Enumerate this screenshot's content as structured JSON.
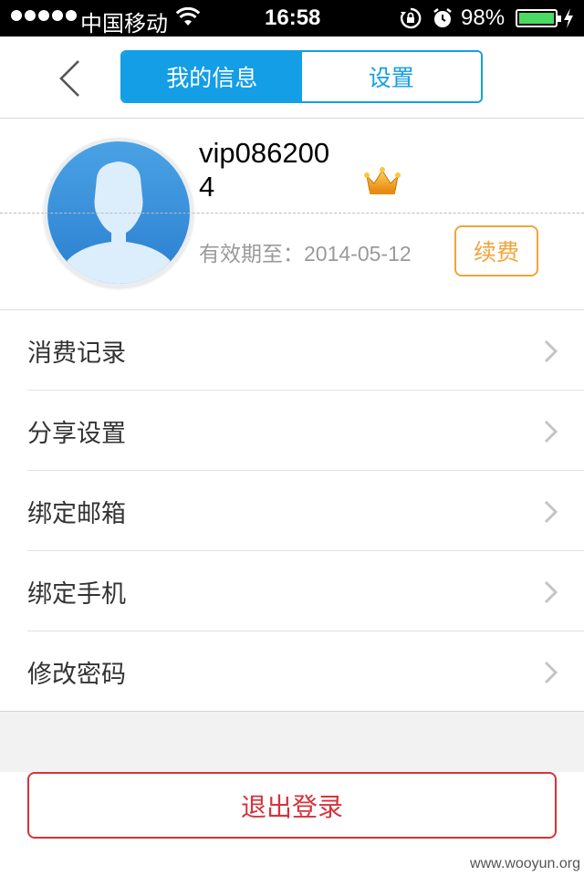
{
  "status_bar": {
    "carrier": "中国移动",
    "time": "16:58",
    "battery": "98%"
  },
  "header": {
    "tabs": [
      {
        "label": "我的信息",
        "active": true
      },
      {
        "label": "设置",
        "active": false
      }
    ]
  },
  "profile": {
    "username": "vip0862004",
    "expiry": "有效期至：2014-05-12",
    "renew_label": "续费"
  },
  "menu": {
    "items": [
      {
        "label": "消费记录"
      },
      {
        "label": "分享设置"
      },
      {
        "label": "绑定邮箱"
      },
      {
        "label": "绑定手机"
      },
      {
        "label": "修改密码"
      }
    ]
  },
  "logout_label": "退出登录",
  "watermark": "www.wooyun.org",
  "colors": {
    "accent": "#139ee6",
    "renew": "#f0a43a",
    "logout": "#d7323a"
  },
  "icons": [
    "back-arrow-icon",
    "crown-icon",
    "chevron-right-icon",
    "wifi-icon",
    "alarm-icon",
    "rotation-lock-icon",
    "battery-icon"
  ]
}
